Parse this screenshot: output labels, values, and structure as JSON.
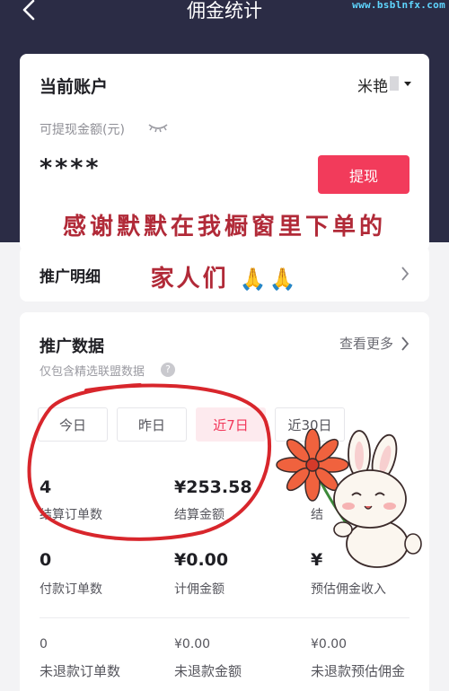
{
  "header": {
    "title": "佣金统计",
    "watermark": "www.bsblnfx.com"
  },
  "account": {
    "title": "当前账户",
    "name": "米艳",
    "withdrawable_label": "可提现金额(元)",
    "balance_masked": "****",
    "withdraw_button": "提现"
  },
  "promo_detail": {
    "label": "推广明细"
  },
  "promo_data": {
    "title": "推广数据",
    "see_more": "查看更多",
    "note": "仅包含精选联盟数据",
    "help_glyph": "?",
    "tabs": [
      {
        "label": "今日"
      },
      {
        "label": "昨日"
      },
      {
        "label": "近7日"
      },
      {
        "label": "近30日"
      }
    ],
    "metrics_row1": [
      {
        "value": "4",
        "label": "结算订单数"
      },
      {
        "value": "¥253.58",
        "label": "结算金额"
      },
      {
        "value": "",
        "label": "结"
      }
    ],
    "metrics_row2": [
      {
        "value": "0",
        "label": "付款订单数"
      },
      {
        "value": "¥0.00",
        "label": "计佣金额"
      },
      {
        "value": "¥",
        "label": "预估佣金收入"
      }
    ],
    "metrics_row3": [
      {
        "value": "0",
        "label": "未退款订单数"
      },
      {
        "value": "¥0.00",
        "label": "未退款金额"
      },
      {
        "value": "¥0.00",
        "label": "未退款预估佣金"
      }
    ]
  },
  "overlay": {
    "line1": "感谢默默在我橱窗里下单的",
    "line2": "家人们",
    "emoji": "🙏🙏"
  },
  "colors": {
    "header_bg": "#2b2c45",
    "accent": "#f23b5b",
    "tab_active_bg": "#fdeaee",
    "annotation_red": "#d8262c"
  }
}
